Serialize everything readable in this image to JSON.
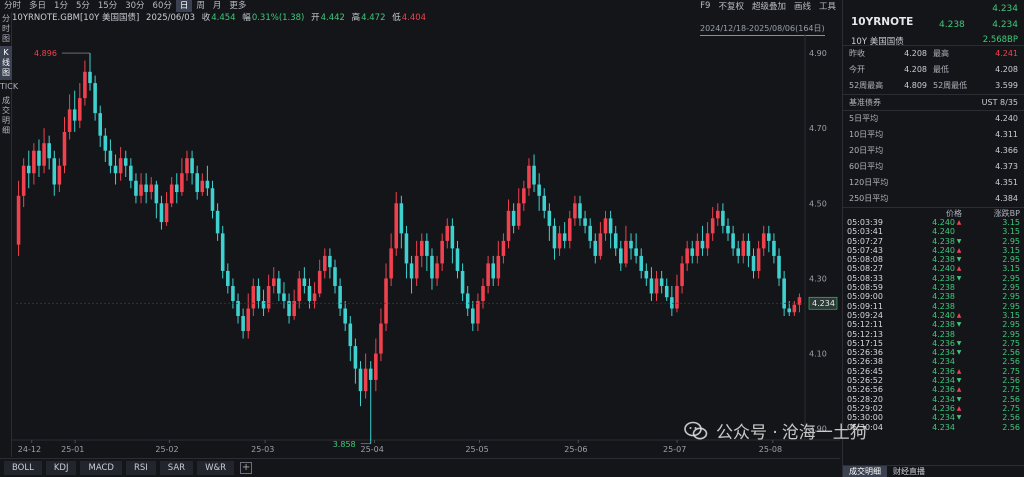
{
  "topbar": {
    "tabs": [
      "分时",
      "多日",
      "1分",
      "5分",
      "15分",
      "30分",
      "60分",
      "日",
      "周",
      "月",
      "更多"
    ],
    "active_tab": "日",
    "tools": [
      "F9",
      "不复权",
      "超级叠加",
      "画线",
      "工具"
    ]
  },
  "infobar": {
    "symbol": "10YRNOTE.GBM[10Y 美国国债]",
    "date": "2025/06/03",
    "close_label": "收",
    "close": "4.454",
    "change_label": "幅",
    "change": "0.31%(1.38)",
    "open_label": "开",
    "open": "4.442",
    "high_label": "高",
    "high": "4.472",
    "low_label": "低",
    "low": "4.404"
  },
  "range_label": "2024/12/18-2025/08/06(164日)",
  "leftbar": [
    "分时图",
    "K线图",
    "TICK",
    "成交明细"
  ],
  "chart_data": {
    "type": "candlestick",
    "y_ticks": [
      "4.90",
      "4.70",
      "4.50",
      "4.30",
      "4.10",
      "3.90"
    ],
    "ylim": [
      3.87,
      4.94
    ],
    "x_ticks": [
      "24-12",
      "25-01",
      "25-02",
      "25-03",
      "25-04",
      "25-05",
      "25-06",
      "25-07",
      "25-08"
    ],
    "annotations": {
      "max": "4.896",
      "min": "3.858",
      "last": "4.234"
    },
    "last": 4.234,
    "up_color": "#f0414e",
    "down_color": "#3fd1cf",
    "candles": [
      [
        4.39,
        4.52,
        4.56,
        4.36
      ],
      [
        4.52,
        4.6,
        4.62,
        4.49
      ],
      [
        4.6,
        4.58,
        4.64,
        4.54
      ],
      [
        4.58,
        4.64,
        4.66,
        4.55
      ],
      [
        4.64,
        4.6,
        4.67,
        4.57
      ],
      [
        4.6,
        4.66,
        4.7,
        4.58
      ],
      [
        4.66,
        4.62,
        4.68,
        4.59
      ],
      [
        4.62,
        4.55,
        4.64,
        4.52
      ],
      [
        4.55,
        4.6,
        4.62,
        4.53
      ],
      [
        4.6,
        4.69,
        4.73,
        4.58
      ],
      [
        4.69,
        4.75,
        4.79,
        4.67
      ],
      [
        4.75,
        4.72,
        4.8,
        4.69
      ],
      [
        4.72,
        4.78,
        4.82,
        4.7
      ],
      [
        4.78,
        4.85,
        4.88,
        4.76
      ],
      [
        4.85,
        4.82,
        4.9,
        4.8
      ],
      [
        4.82,
        4.74,
        4.84,
        4.72
      ],
      [
        4.74,
        4.68,
        4.76,
        4.65
      ],
      [
        4.68,
        4.64,
        4.7,
        4.61
      ],
      [
        4.64,
        4.6,
        4.67,
        4.58
      ],
      [
        4.6,
        4.58,
        4.63,
        4.55
      ],
      [
        4.58,
        4.62,
        4.65,
        4.56
      ],
      [
        4.62,
        4.6,
        4.64,
        4.57
      ],
      [
        4.6,
        4.56,
        4.62,
        4.54
      ],
      [
        4.56,
        4.52,
        4.58,
        4.5
      ],
      [
        4.52,
        4.55,
        4.58,
        4.5
      ],
      [
        4.55,
        4.53,
        4.58,
        4.5
      ],
      [
        4.53,
        4.55,
        4.57,
        4.51
      ],
      [
        4.55,
        4.5,
        4.56,
        4.46
      ],
      [
        4.5,
        4.45,
        4.52,
        4.43
      ],
      [
        4.45,
        4.5,
        4.53,
        4.44
      ],
      [
        4.5,
        4.55,
        4.57,
        4.49
      ],
      [
        4.55,
        4.53,
        4.58,
        4.5
      ],
      [
        4.53,
        4.58,
        4.62,
        4.52
      ],
      [
        4.58,
        4.62,
        4.64,
        4.56
      ],
      [
        4.62,
        4.58,
        4.64,
        4.55
      ],
      [
        4.58,
        4.53,
        4.6,
        4.51
      ],
      [
        4.53,
        4.56,
        4.58,
        4.52
      ],
      [
        4.56,
        4.54,
        4.6,
        4.52
      ],
      [
        4.54,
        4.48,
        4.56,
        4.46
      ],
      [
        4.48,
        4.42,
        4.5,
        4.4
      ],
      [
        4.42,
        4.32,
        4.44,
        4.3
      ],
      [
        4.32,
        4.28,
        4.34,
        4.26
      ],
      [
        4.28,
        4.24,
        4.3,
        4.22
      ],
      [
        4.24,
        4.2,
        4.26,
        4.18
      ],
      [
        4.2,
        4.16,
        4.22,
        4.14
      ],
      [
        4.16,
        4.22,
        4.26,
        4.14
      ],
      [
        4.22,
        4.28,
        4.3,
        4.2
      ],
      [
        4.28,
        4.24,
        4.3,
        4.22
      ],
      [
        4.24,
        4.22,
        4.27,
        4.2
      ],
      [
        4.22,
        4.28,
        4.31,
        4.21
      ],
      [
        4.28,
        4.3,
        4.33,
        4.26
      ],
      [
        4.3,
        4.26,
        4.32,
        4.24
      ],
      [
        4.26,
        4.24,
        4.29,
        4.22
      ],
      [
        4.24,
        4.2,
        4.26,
        4.18
      ],
      [
        4.2,
        4.24,
        4.27,
        4.19
      ],
      [
        4.24,
        4.3,
        4.32,
        4.22
      ],
      [
        4.3,
        4.28,
        4.33,
        4.26
      ],
      [
        4.28,
        4.24,
        4.3,
        4.22
      ],
      [
        4.24,
        4.26,
        4.29,
        4.22
      ],
      [
        4.26,
        4.32,
        4.35,
        4.25
      ],
      [
        4.32,
        4.36,
        4.38,
        4.3
      ],
      [
        4.36,
        4.33,
        4.38,
        4.3
      ],
      [
        4.33,
        4.28,
        4.35,
        4.26
      ],
      [
        4.28,
        4.22,
        4.3,
        4.2
      ],
      [
        4.22,
        4.18,
        4.24,
        4.16
      ],
      [
        4.18,
        4.12,
        4.2,
        4.08
      ],
      [
        4.12,
        4.06,
        4.14,
        4.02
      ],
      [
        4.06,
        4.0,
        4.08,
        3.96
      ],
      [
        4.0,
        4.06,
        4.1,
        3.98
      ],
      [
        4.06,
        4.03,
        4.08,
        3.86
      ],
      [
        4.03,
        4.1,
        4.14,
        4.0
      ],
      [
        4.1,
        4.18,
        4.22,
        4.08
      ],
      [
        4.18,
        4.3,
        4.34,
        4.16
      ],
      [
        4.3,
        4.38,
        4.42,
        4.28
      ],
      [
        4.38,
        4.5,
        4.53,
        4.36
      ],
      [
        4.5,
        4.42,
        4.52,
        4.38
      ],
      [
        4.42,
        4.34,
        4.44,
        4.3
      ],
      [
        4.34,
        4.3,
        4.36,
        4.26
      ],
      [
        4.3,
        4.36,
        4.4,
        4.28
      ],
      [
        4.36,
        4.4,
        4.42,
        4.33
      ],
      [
        4.4,
        4.36,
        4.42,
        4.32
      ],
      [
        4.36,
        4.3,
        4.38,
        4.27
      ],
      [
        4.3,
        4.34,
        4.36,
        4.28
      ],
      [
        4.34,
        4.4,
        4.42,
        4.32
      ],
      [
        4.4,
        4.44,
        4.46,
        4.38
      ],
      [
        4.44,
        4.38,
        4.46,
        4.34
      ],
      [
        4.38,
        4.32,
        4.4,
        4.3
      ],
      [
        4.32,
        4.26,
        4.34,
        4.24
      ],
      [
        4.26,
        4.22,
        4.28,
        4.2
      ],
      [
        4.22,
        4.18,
        4.24,
        4.16
      ],
      [
        4.18,
        4.24,
        4.26,
        4.16
      ],
      [
        4.24,
        4.28,
        4.3,
        4.22
      ],
      [
        4.28,
        4.34,
        4.36,
        4.26
      ],
      [
        4.34,
        4.3,
        4.36,
        4.28
      ],
      [
        4.3,
        4.36,
        4.4,
        4.28
      ],
      [
        4.36,
        4.4,
        4.42,
        4.34
      ],
      [
        4.4,
        4.48,
        4.51,
        4.38
      ],
      [
        4.48,
        4.44,
        4.5,
        4.42
      ],
      [
        4.44,
        4.5,
        4.54,
        4.43
      ],
      [
        4.5,
        4.54,
        4.56,
        4.48
      ],
      [
        4.54,
        4.6,
        4.62,
        4.52
      ],
      [
        4.6,
        4.55,
        4.63,
        4.53
      ],
      [
        4.55,
        4.52,
        4.58,
        4.48
      ],
      [
        4.52,
        4.48,
        4.54,
        4.46
      ],
      [
        4.48,
        4.44,
        4.5,
        4.4
      ],
      [
        4.44,
        4.38,
        4.46,
        4.35
      ],
      [
        4.38,
        4.42,
        4.44,
        4.36
      ],
      [
        4.42,
        4.4,
        4.45,
        4.38
      ],
      [
        4.4,
        4.46,
        4.48,
        4.38
      ],
      [
        4.46,
        4.5,
        4.52,
        4.44
      ],
      [
        4.5,
        4.46,
        4.52,
        4.44
      ],
      [
        4.46,
        4.44,
        4.48,
        4.42
      ],
      [
        4.44,
        4.4,
        4.46,
        4.38
      ],
      [
        4.4,
        4.36,
        4.42,
        4.34
      ],
      [
        4.36,
        4.42,
        4.45,
        4.35
      ],
      [
        4.42,
        4.46,
        4.48,
        4.4
      ],
      [
        4.46,
        4.42,
        4.48,
        4.38
      ],
      [
        4.42,
        4.38,
        4.44,
        4.36
      ],
      [
        4.38,
        4.34,
        4.4,
        4.32
      ],
      [
        4.34,
        4.4,
        4.44,
        4.33
      ],
      [
        4.4,
        4.38,
        4.42,
        4.35
      ],
      [
        4.38,
        4.36,
        4.42,
        4.34
      ],
      [
        4.36,
        4.32,
        4.38,
        4.3
      ],
      [
        4.32,
        4.3,
        4.34,
        4.28
      ],
      [
        4.3,
        4.26,
        4.33,
        4.24
      ],
      [
        4.26,
        4.3,
        4.32,
        4.24
      ],
      [
        4.3,
        4.28,
        4.32,
        4.26
      ],
      [
        4.28,
        4.25,
        4.3,
        4.24
      ],
      [
        4.25,
        4.22,
        4.28,
        4.2
      ],
      [
        4.22,
        4.28,
        4.31,
        4.21
      ],
      [
        4.28,
        4.34,
        4.36,
        4.26
      ],
      [
        4.34,
        4.38,
        4.4,
        4.32
      ],
      [
        4.38,
        4.36,
        4.4,
        4.34
      ],
      [
        4.36,
        4.4,
        4.42,
        4.34
      ],
      [
        4.4,
        4.38,
        4.44,
        4.36
      ],
      [
        4.38,
        4.42,
        4.45,
        4.36
      ],
      [
        4.42,
        4.46,
        4.49,
        4.4
      ],
      [
        4.46,
        4.48,
        4.5,
        4.44
      ],
      [
        4.48,
        4.44,
        4.5,
        4.42
      ],
      [
        4.44,
        4.42,
        4.46,
        4.4
      ],
      [
        4.42,
        4.38,
        4.44,
        4.36
      ],
      [
        4.38,
        4.36,
        4.4,
        4.34
      ],
      [
        4.36,
        4.4,
        4.42,
        4.34
      ],
      [
        4.4,
        4.36,
        4.42,
        4.33
      ],
      [
        4.36,
        4.32,
        4.38,
        4.3
      ],
      [
        4.32,
        4.38,
        4.4,
        4.3
      ],
      [
        4.38,
        4.42,
        4.44,
        4.36
      ],
      [
        4.42,
        4.4,
        4.44,
        4.37
      ],
      [
        4.4,
        4.36,
        4.42,
        4.34
      ],
      [
        4.36,
        4.3,
        4.38,
        4.28
      ],
      [
        4.3,
        4.22,
        4.32,
        4.2
      ],
      [
        4.22,
        4.21,
        4.24,
        4.2
      ],
      [
        4.21,
        4.23,
        4.24,
        4.2
      ],
      [
        4.23,
        4.25,
        4.26,
        4.21
      ]
    ]
  },
  "bottombar": {
    "indicators": [
      "BOLL",
      "KDJ",
      "MACD",
      "RSI",
      "SAR",
      "W&R"
    ],
    "add": "+"
  },
  "right": {
    "symbol": "10YRNOTE",
    "price_top": "4.234",
    "price_left": "4.238",
    "price_right": "4.234",
    "name": "10Y 美国国债",
    "yield": "2.568BP",
    "quotes": [
      {
        "l": "昨收",
        "v": "4.208",
        "l2": "最高",
        "v2": "4.241",
        "c": "",
        "c2": "red"
      },
      {
        "l": "今开",
        "v": "4.208",
        "l2": "最低",
        "v2": "4.208",
        "c": "",
        "c2": ""
      },
      {
        "l": "52周最高",
        "v": "4.809",
        "l2": "52周最低",
        "v2": "3.599",
        "c": "",
        "c2": ""
      }
    ],
    "base_label": "基准债券",
    "base_value": "UST 8/35",
    "averages": [
      {
        "l": "5日平均",
        "v": "4.240"
      },
      {
        "l": "10日平均",
        "v": "4.311"
      },
      {
        "l": "20日平均",
        "v": "4.366"
      },
      {
        "l": "60日平均",
        "v": "4.373"
      },
      {
        "l": "120日平均",
        "v": "4.351"
      },
      {
        "l": "250日平均",
        "v": "4.384"
      }
    ],
    "table_headers": [
      "价格",
      "涨跌BP"
    ],
    "ticks": [
      {
        "t": "05:03:39",
        "p": "4.240",
        "d": "up",
        "s": "3.15"
      },
      {
        "t": "05:03:41",
        "p": "4.240",
        "d": "",
        "s": "3.15"
      },
      {
        "t": "05:07:27",
        "p": "4.238",
        "d": "dn",
        "s": "2.95"
      },
      {
        "t": "05:07:43",
        "p": "4.240",
        "d": "up",
        "s": "3.15"
      },
      {
        "t": "05:08:08",
        "p": "4.238",
        "d": "dn",
        "s": "2.95"
      },
      {
        "t": "05:08:27",
        "p": "4.240",
        "d": "up",
        "s": "3.15"
      },
      {
        "t": "05:08:33",
        "p": "4.238",
        "d": "dn",
        "s": "2.95"
      },
      {
        "t": "05:08:59",
        "p": "4.238",
        "d": "",
        "s": "2.95"
      },
      {
        "t": "05:09:00",
        "p": "4.238",
        "d": "",
        "s": "2.95"
      },
      {
        "t": "05:09:11",
        "p": "4.238",
        "d": "",
        "s": "2.95"
      },
      {
        "t": "05:09:24",
        "p": "4.240",
        "d": "up",
        "s": "3.15"
      },
      {
        "t": "05:12:11",
        "p": "4.238",
        "d": "dn",
        "s": "2.95"
      },
      {
        "t": "05:12:13",
        "p": "4.238",
        "d": "",
        "s": "2.95"
      },
      {
        "t": "05:17:15",
        "p": "4.236",
        "d": "dn",
        "s": "2.75"
      },
      {
        "t": "05:26:36",
        "p": "4.234",
        "d": "dn",
        "s": "2.56"
      },
      {
        "t": "05:26:38",
        "p": "4.234",
        "d": "",
        "s": "2.56"
      },
      {
        "t": "05:26:45",
        "p": "4.236",
        "d": "up",
        "s": "2.75"
      },
      {
        "t": "05:26:52",
        "p": "4.234",
        "d": "dn",
        "s": "2.56"
      },
      {
        "t": "05:26:56",
        "p": "4.236",
        "d": "up",
        "s": "2.75"
      },
      {
        "t": "05:28:20",
        "p": "4.234",
        "d": "dn",
        "s": "2.56"
      },
      {
        "t": "05:29:02",
        "p": "4.236",
        "d": "up",
        "s": "2.75"
      },
      {
        "t": "05:30:00",
        "p": "4.234",
        "d": "dn",
        "s": "2.56"
      },
      {
        "t": "05:30:04",
        "p": "4.234",
        "d": "",
        "s": "2.56"
      }
    ],
    "tabs": [
      "成交明细",
      "财经直播"
    ]
  },
  "watermark": {
    "prefix": "公众号 · ",
    "name": "沧海一土狗"
  }
}
